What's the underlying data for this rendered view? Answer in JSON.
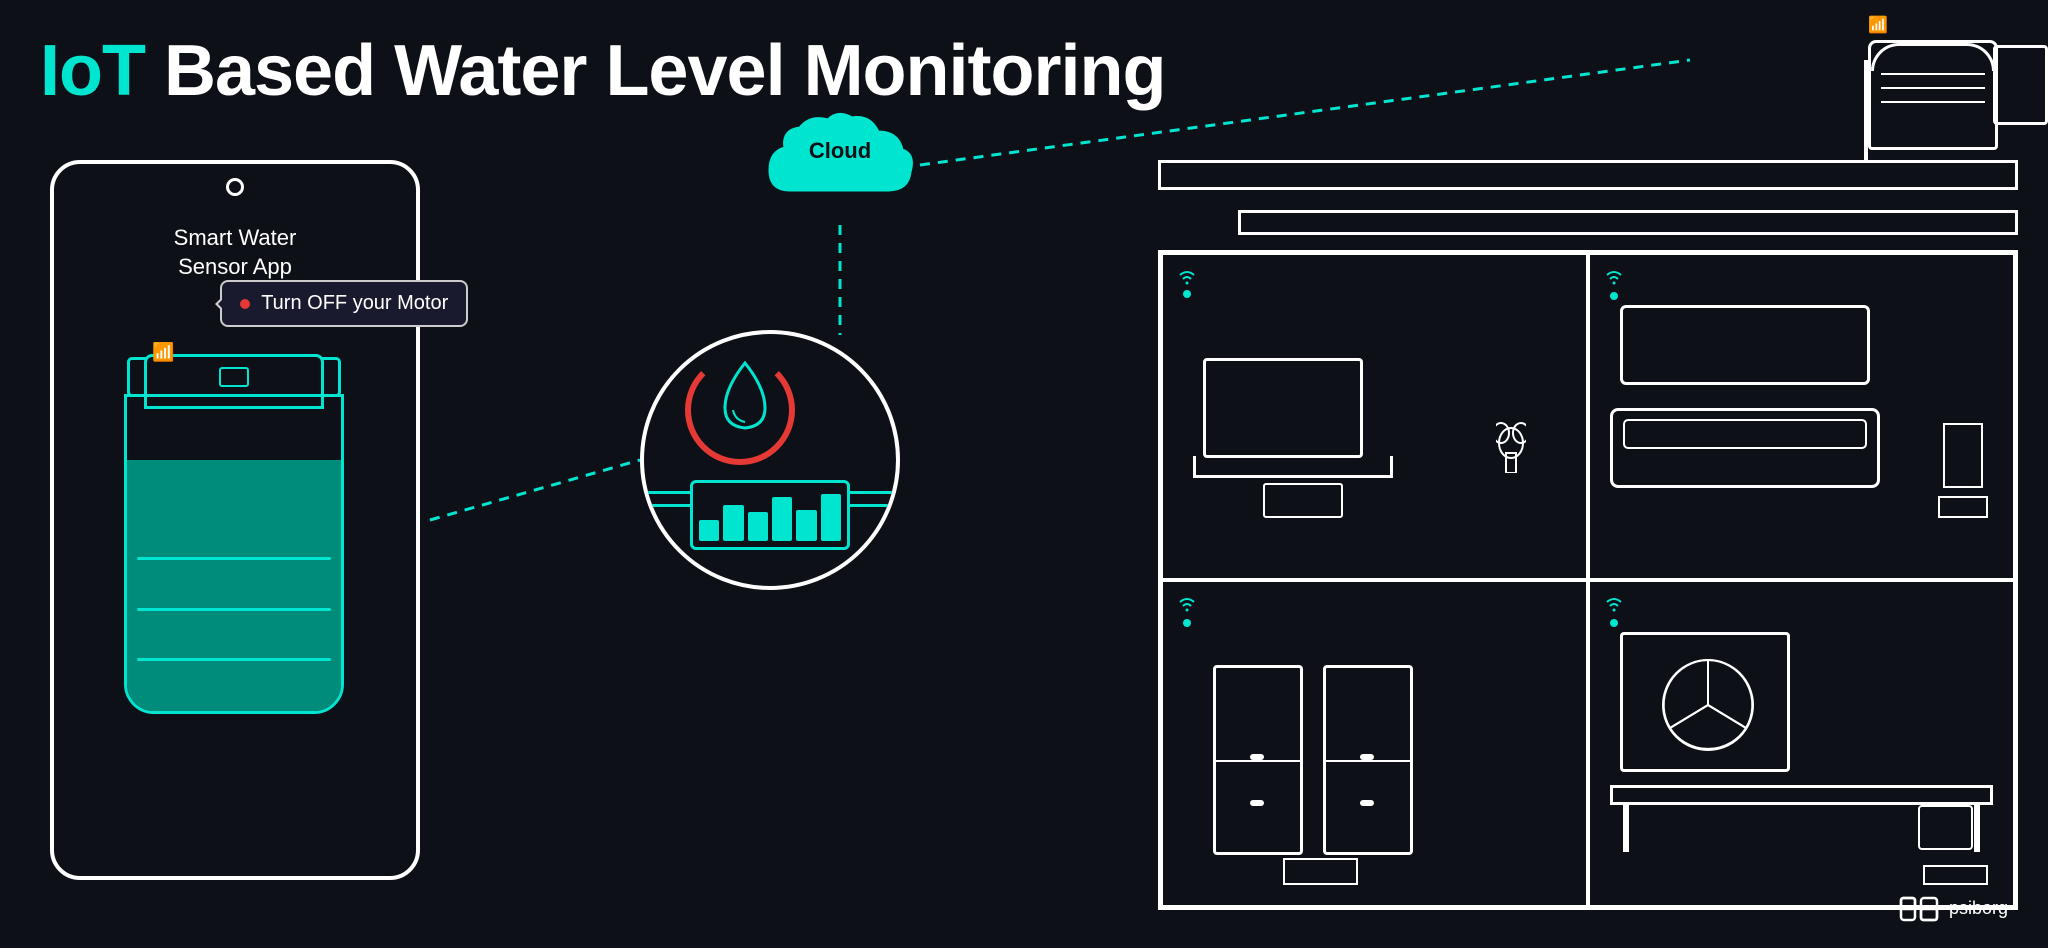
{
  "title": {
    "iot": "IoT",
    "rest": " Based Water Level Monitoring"
  },
  "app": {
    "name": "Smart Water\nSensor App"
  },
  "notification": {
    "text": "Turn OFF your Motor"
  },
  "cloud": {
    "label": "Cloud"
  },
  "brand": {
    "name": "psiborg"
  },
  "colors": {
    "teal": "#00e5d0",
    "red": "#e53935",
    "white": "#ffffff",
    "dark": "#0d1117",
    "tank_fill": "#008c7a"
  },
  "bars": [
    {
      "height": "40%"
    },
    {
      "height": "70%"
    },
    {
      "height": "55%"
    },
    {
      "height": "85%"
    },
    {
      "height": "60%"
    },
    {
      "height": "90%"
    }
  ]
}
